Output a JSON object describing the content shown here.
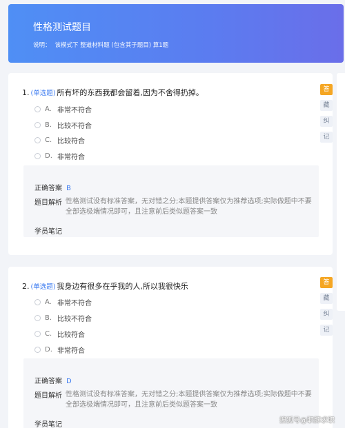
{
  "header": {
    "title": "性格测试题目",
    "desc_label": "说明：",
    "desc_text": "该模式下 整道材料题 (包含其子题目) 算1题"
  },
  "questions": [
    {
      "number": "1.",
      "type": "(单选题)",
      "text": "所有坏的东西我都会留着,因为不舍得扔掉。",
      "options": [
        {
          "letter": "A.",
          "label": "非常不符合"
        },
        {
          "letter": "B.",
          "label": "比较不符合"
        },
        {
          "letter": "C.",
          "label": "比较符合"
        },
        {
          "letter": "D.",
          "label": "非常符合"
        }
      ],
      "answer_label": "正确答案",
      "answer_value": "B",
      "analysis_label": "题目解析",
      "analysis_text": "性格测试没有标准答案，无对错之分;本题提供答案仅为推荐选项;实际做题中不要全部选极端情况即可，且注意前后类似题答案一致",
      "notes_label": "学员笔记",
      "tags": [
        "答",
        "藏",
        "纠",
        "记"
      ]
    },
    {
      "number": "2.",
      "type": "(单选题)",
      "text": "我身边有很多在乎我的人,所以我很快乐",
      "options": [
        {
          "letter": "A.",
          "label": "非常不符合"
        },
        {
          "letter": "B.",
          "label": "比较不符合"
        },
        {
          "letter": "C.",
          "label": "比较符合"
        },
        {
          "letter": "D.",
          "label": "非常符合"
        }
      ],
      "answer_label": "正确答案",
      "answer_value": "D",
      "analysis_label": "题目解析",
      "analysis_text": "性格测试没有标准答案，无对错之分;本题提供答案仅为推荐选项;实际做题中不要全部选极端情况即可，且注意前后类似题答案一致",
      "notes_label": "学员笔记",
      "tags": [
        "答",
        "藏",
        "纠",
        "记"
      ]
    }
  ],
  "watermark": "搜狐号@职豚求职",
  "colors": {
    "accent": "#3c7bf0",
    "tag_active": "#f5a623",
    "header_start": "#4f8ff5",
    "header_end": "#6a6ee9"
  }
}
